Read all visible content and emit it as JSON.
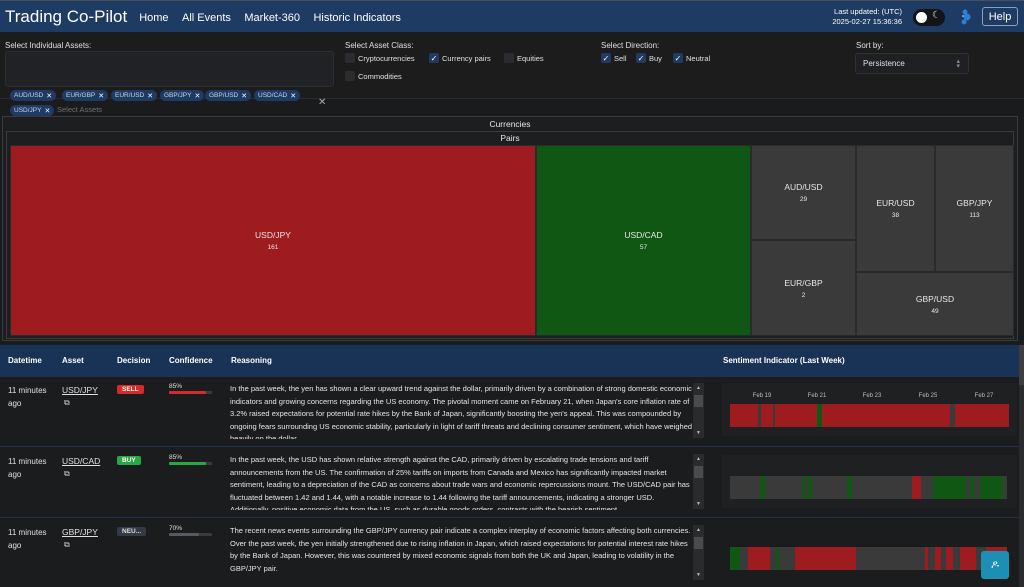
{
  "header": {
    "brand": "Trading Co-Pilot",
    "nav": [
      "Home",
      "All Events",
      "Market-360",
      "Historic Indicators"
    ],
    "updated_label": "Last updated: (UTC)",
    "updated_value": "2025-02-27 15:36:36",
    "help_label": "Help",
    "theme_toggle_icon": "moon-icon"
  },
  "filters": {
    "assets_label": "Select Individual Assets:",
    "assets_selected": [
      "AUD/USD",
      "EUR/GBP",
      "EUR/USD",
      "GBP/JPY",
      "GBP/USD",
      "USD/CAD",
      "USD/JPY"
    ],
    "assets_placeholder": "Select Assets",
    "asset_class_label": "Select Asset Class:",
    "asset_classes": [
      {
        "label": "Cryptocurrencies",
        "checked": false
      },
      {
        "label": "Currency pairs",
        "checked": true
      },
      {
        "label": "Equities",
        "checked": false
      },
      {
        "label": "Commodities",
        "checked": false
      }
    ],
    "direction_label": "Select Direction:",
    "directions": [
      {
        "label": "Sell",
        "checked": true
      },
      {
        "label": "Buy",
        "checked": true
      },
      {
        "label": "Neutral",
        "checked": true
      }
    ],
    "sort_label": "Sort by:",
    "sort_value": "Persistence"
  },
  "treemap": {
    "root": "Currencies",
    "group": "Pairs",
    "tiles": [
      {
        "name": "USD/JPY",
        "value": "161",
        "direction": "sell"
      },
      {
        "name": "USD/CAD",
        "value": "57",
        "direction": "buy"
      },
      {
        "name": "AUD/USD",
        "value": "29",
        "direction": "neutral"
      },
      {
        "name": "EUR/GBP",
        "value": "2",
        "direction": "neutral"
      },
      {
        "name": "EUR/USD",
        "value": "38",
        "direction": "neutral"
      },
      {
        "name": "GBP/JPY",
        "value": "113",
        "direction": "neutral"
      },
      {
        "name": "GBP/USD",
        "value": "49",
        "direction": "neutral"
      }
    ]
  },
  "table": {
    "columns": [
      "Datetime",
      "Asset",
      "Decision",
      "Confidence",
      "Reasoning",
      "Sentiment Indicator (Last Week)"
    ],
    "sentiment_dates": [
      "Feb 19",
      "Feb 21",
      "Feb 23",
      "Feb 25",
      "Feb 27"
    ],
    "rows": [
      {
        "datetime": "11 minutes ago",
        "asset": "USD/JPY",
        "decision": "SELL",
        "confidence": "85%",
        "confidence_value": 0.85,
        "reasoning": "In the past week, the yen has shown a clear upward trend against the dollar, primarily driven by a combination of strong domestic economic indicators and growing concerns regarding the US economy. The pivotal moment came on February 21, when Japan's core inflation rate of 3.2% raised expectations for potential rate hikes by the Bank of Japan, significantly boosting the yen's appeal. This was compounded by ongoing fears surrounding US economic stability, particularly in light of tariff threats and declining consumer sentiment, which have weighed heavily on the dollar."
      },
      {
        "datetime": "11 minutes ago",
        "asset": "USD/CAD",
        "decision": "BUY",
        "confidence": "85%",
        "confidence_value": 0.85,
        "reasoning": "In the past week, the USD has shown relative strength against the CAD, primarily driven by escalating trade tensions and tariff announcements from the US. The confirmation of 25% tariffs on imports from Canada and Mexico has significantly impacted market sentiment, leading to a depreciation of the CAD as concerns about trade wars and economic repercussions mount. The USD/CAD pair has fluctuated between 1.42 and 1.44, with a notable increase to 1.44 following the tariff announcements, indicating a stronger USD. Additionally, positive economic data from the US, such as durable goods orders, contrasts with the bearish sentiment."
      },
      {
        "datetime": "11 minutes ago",
        "asset": "GBP/JPY",
        "decision": "NEU...",
        "confidence": "70%",
        "confidence_value": 0.7,
        "reasoning": "The recent news events surrounding the GBP/JPY currency pair indicate a complex interplay of economic factors affecting both currencies. Over the past week, the yen initially strengthened due to rising inflation in Japan, which raised expectations for potential interest rate hikes by the Bank of Japan. However, this was countered by mixed economic signals from both the UK and Japan, leading to volatility in the GBP/JPY pair."
      }
    ]
  },
  "colors": {
    "header_bg": "#1d3b63",
    "sell": "#9e1b1f",
    "buy": "#0f5712",
    "neutral": "#3a3a3b",
    "sell_badge": "#d42a2a",
    "buy_badge": "#27a844"
  }
}
